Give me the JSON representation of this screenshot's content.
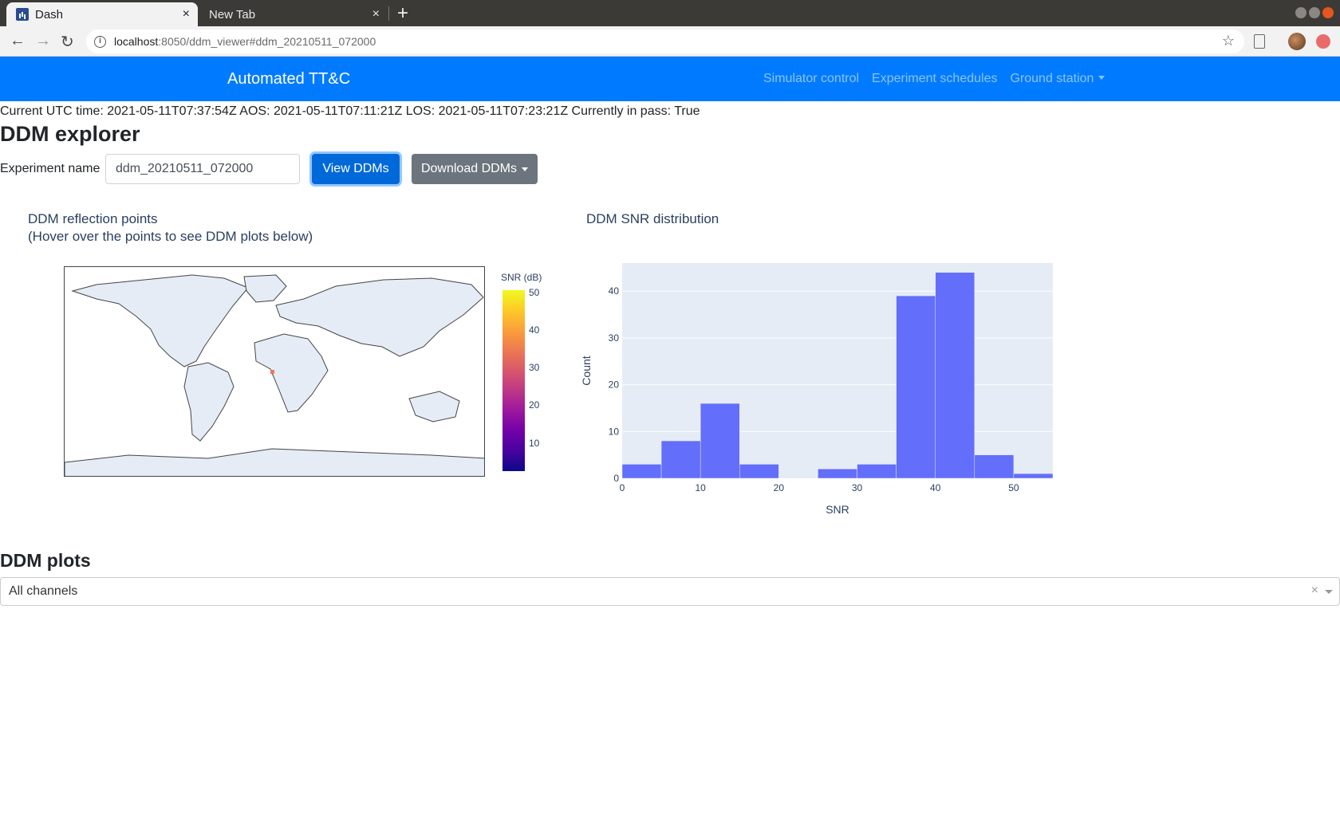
{
  "browser": {
    "tabs": [
      {
        "label": "Dash",
        "close": "×"
      },
      {
        "label": "New Tab",
        "close": "×"
      }
    ],
    "new_tab": "+",
    "url_host": "localhost",
    "url_path": ":8050/ddm_viewer#ddm_20210511_072000"
  },
  "navbar": {
    "brand": "Automated TT&C",
    "links": [
      "Simulator control",
      "Experiment schedules",
      "Ground station"
    ],
    "color": "#007bff"
  },
  "status_line": "Current UTC time: 2021-05-11T07:37:54Z AOS: 2021-05-11T07:11:21Z LOS: 2021-05-11T07:23:21Z Currently in pass: True",
  "page_title": "DDM explorer",
  "experiment": {
    "label": "Experiment name",
    "value": "ddm_20210511_072000",
    "view_button": "View DDMs",
    "download_button": "Download DDMs"
  },
  "map_plot": {
    "title_line1": "DDM reflection points",
    "title_line2": "(Hover over the points to see DDM plots below)",
    "colorbar_title": "SNR (dB)",
    "colorbar_ticks": [
      "50",
      "40",
      "30",
      "20",
      "10"
    ],
    "point_color": "#ed7953"
  },
  "chart_data": {
    "type": "bar",
    "title": "DDM SNR distribution",
    "xlabel": "SNR",
    "ylabel": "Count",
    "bin_edges": [
      0,
      5,
      10,
      15,
      20,
      25,
      30,
      35,
      40,
      45,
      50,
      55
    ],
    "values": [
      3,
      8,
      16,
      3,
      0,
      2,
      3,
      39,
      44,
      5,
      1
    ],
    "xlim": [
      0,
      55
    ],
    "ylim": [
      0,
      46
    ],
    "xticks": [
      0,
      10,
      20,
      30,
      40,
      50
    ],
    "yticks": [
      0,
      10,
      20,
      30,
      40
    ],
    "bar_color": "#636efa",
    "plot_bg": "#e5ecf6",
    "grid": true
  },
  "ddm_plots": {
    "title": "DDM plots",
    "select_value": "All channels",
    "clear": "×"
  }
}
